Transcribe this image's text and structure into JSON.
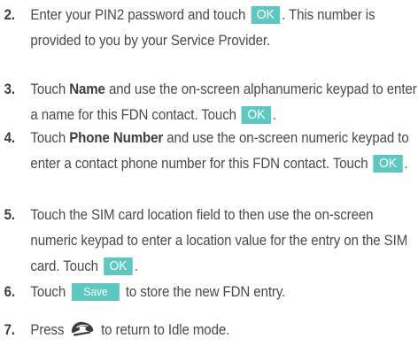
{
  "steps": [
    {
      "num": "2.",
      "parts": [
        {
          "t": "text",
          "v": "Enter your PIN2 password and touch "
        },
        {
          "t": "ok",
          "v": "OK"
        },
        {
          "t": "text",
          "v": ". This number is provided to you by your Service Provider."
        }
      ]
    },
    {
      "num": "3.",
      "parts": [
        {
          "t": "text",
          "v": "Touch "
        },
        {
          "t": "bold",
          "v": "Name"
        },
        {
          "t": "text",
          "v": " and use the on-screen alphanumeric keypad to enter a name for this FDN contact. Touch "
        },
        {
          "t": "ok",
          "v": "OK"
        },
        {
          "t": "text",
          "v": "."
        }
      ]
    },
    {
      "num": "4.",
      "parts": [
        {
          "t": "text",
          "v": "Touch "
        },
        {
          "t": "bold",
          "v": "Phone Number"
        },
        {
          "t": "text",
          "v": " and use the on-screen numeric keypad to enter a contact phone number for this FDN contact. Touch "
        },
        {
          "t": "ok",
          "v": "OK"
        },
        {
          "t": "text",
          "v": "."
        }
      ]
    },
    {
      "num": "5.",
      "parts": [
        {
          "t": "text",
          "v": "Touch the SIM card location field to then use the on-screen numeric keypad to enter a location value for the entry on the SIM card. Touch "
        },
        {
          "t": "ok",
          "v": "OK"
        },
        {
          "t": "text",
          "v": "."
        }
      ]
    },
    {
      "num": "6.",
      "parts": [
        {
          "t": "text",
          "v": "Touch "
        },
        {
          "t": "save",
          "v": "Save"
        },
        {
          "t": "text",
          "v": " to store the new FDN entry."
        }
      ]
    },
    {
      "num": "7.",
      "parts": [
        {
          "t": "text",
          "v": "Press "
        },
        {
          "t": "icon",
          "v": "end-call-key-icon"
        },
        {
          "t": "text",
          "v": " to return to Idle mode."
        }
      ]
    }
  ],
  "colors": {
    "button_bg": "#5ec8c0",
    "text": "#4a4a4a"
  }
}
